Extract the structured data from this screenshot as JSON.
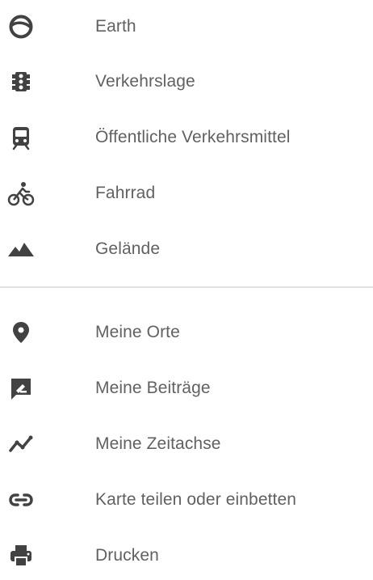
{
  "menu": {
    "layers": [
      {
        "label": "Earth",
        "icon": "earth-icon"
      },
      {
        "label": "Verkehrslage",
        "icon": "traffic-light-icon"
      },
      {
        "label": "Öffentliche Verkehrsmittel",
        "icon": "transit-train-icon"
      },
      {
        "label": "Fahrrad",
        "icon": "bicycle-icon"
      },
      {
        "label": "Gelände",
        "icon": "terrain-icon"
      }
    ],
    "actions": [
      {
        "label": "Meine Orte",
        "icon": "place-pin-icon"
      },
      {
        "label": "Meine Beiträge",
        "icon": "edit-contributions-icon"
      },
      {
        "label": "Meine Zeitachse",
        "icon": "timeline-icon"
      },
      {
        "label": "Karte teilen oder einbetten",
        "icon": "link-icon"
      },
      {
        "label": "Drucken",
        "icon": "print-icon"
      }
    ]
  },
  "colors": {
    "icon": "#424242",
    "text": "#616161",
    "divider": "#e0e0e0",
    "background": "#ffffff"
  }
}
